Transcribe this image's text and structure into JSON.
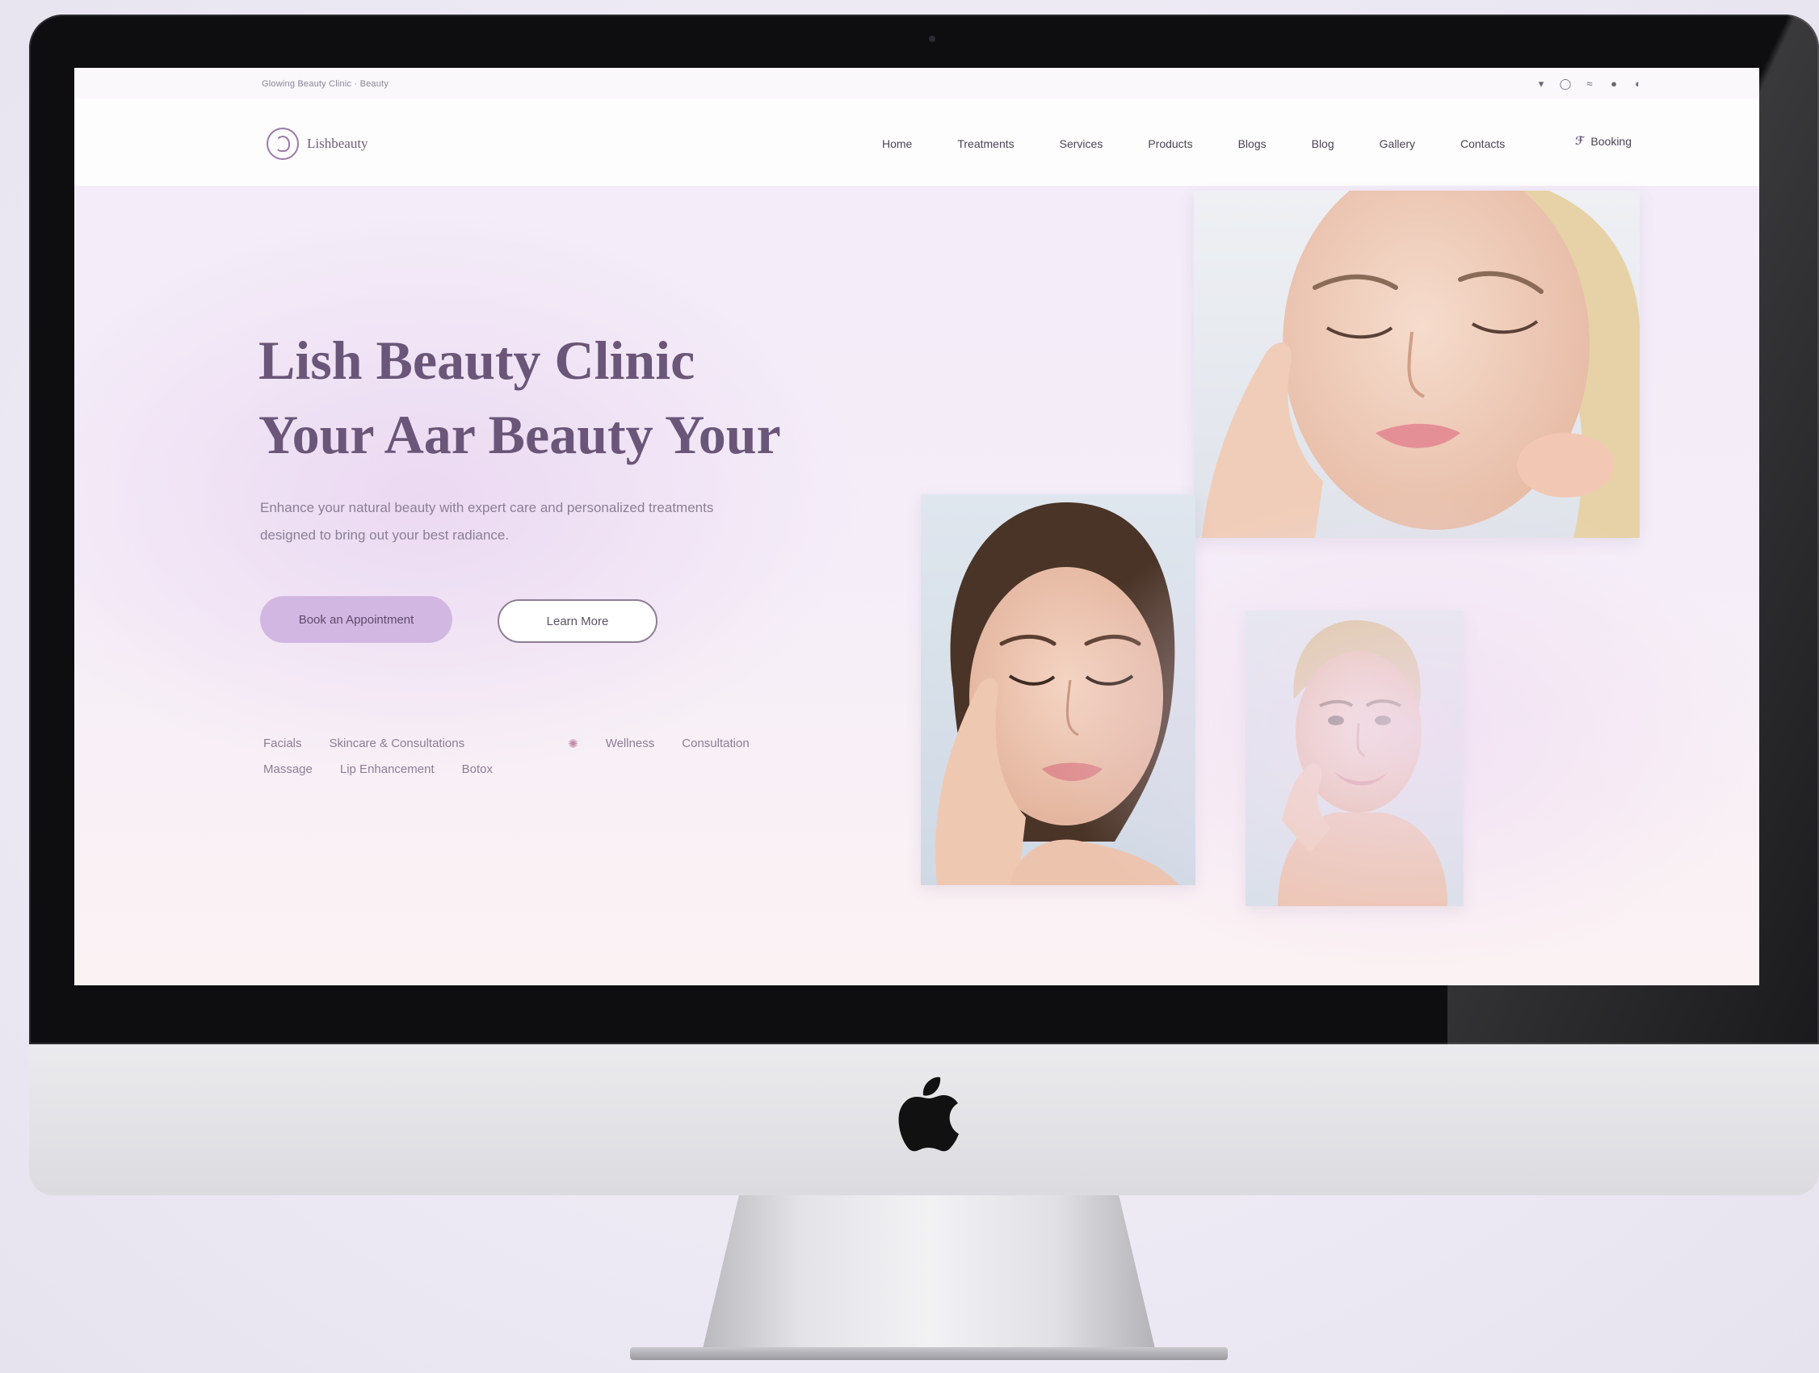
{
  "site": {
    "topbar_text": "Glowing Beauty Clinic · Beauty",
    "social_icons": [
      "location-icon",
      "instagram-icon",
      "twitter-icon",
      "pinterest-icon",
      "globe-icon"
    ],
    "logo_text": "Lishbeauty",
    "nav": [
      "Home",
      "Treatments",
      "Services",
      "Products",
      "Blogs",
      "Blog",
      "Gallery",
      "Contacts"
    ],
    "nav_cta": "Booking",
    "headline_line1": "Lish Beauty Clinic",
    "headline_line2": "Your Aar Beauty Your",
    "subtext_line1": "Enhance your natural beauty with expert care and personalized treatments",
    "subtext_line2": "designed to bring out your best radiance.",
    "primary_button": "Book an Appointment",
    "secondary_button": "Learn More",
    "features_row1": [
      "Facials",
      "Skincare & Consultations",
      "Wellness",
      "Consultation"
    ],
    "features_row2": [
      "Massage",
      "Lip Enhancement",
      "Botox"
    ]
  },
  "colors": {
    "headline": "#6a5679",
    "primary_button": "#d2b7e2",
    "accent": "#9c7aa8"
  }
}
